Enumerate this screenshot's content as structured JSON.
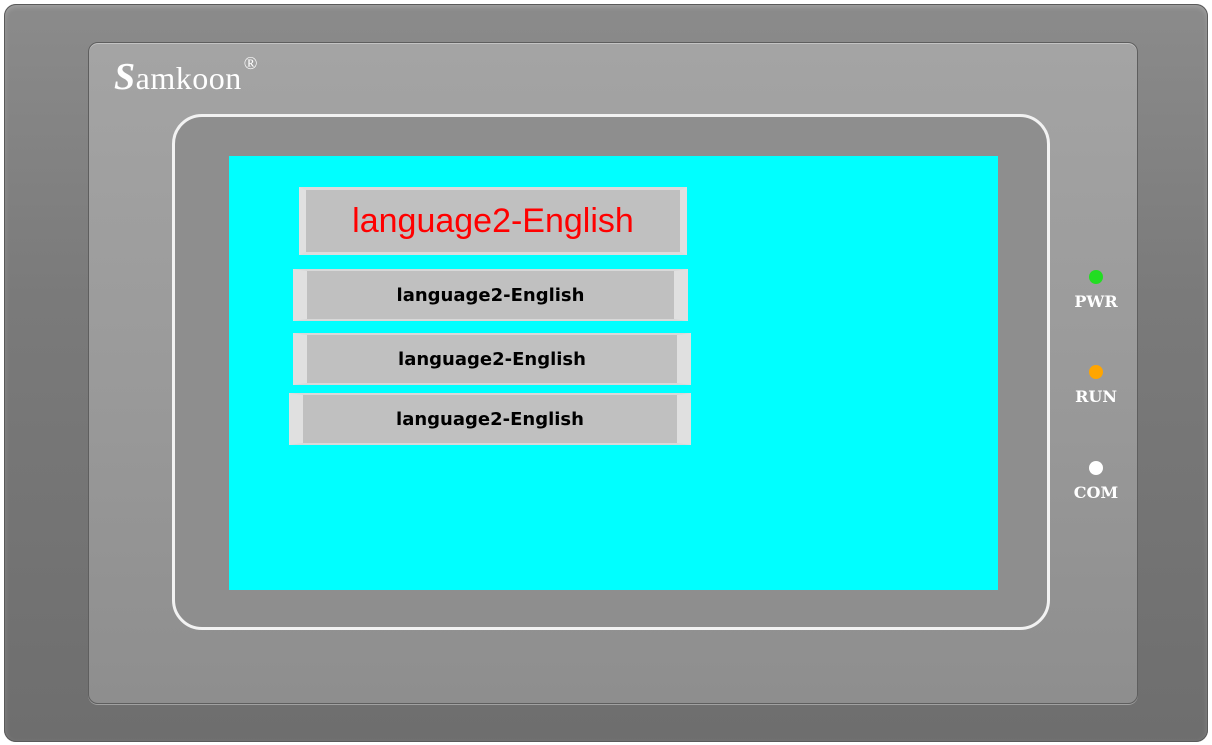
{
  "device": {
    "brand": "Samkoon",
    "brand_initial": "S",
    "brand_rest": "amkoon",
    "registered_mark": "®"
  },
  "screen": {
    "background_color": "#00ffff",
    "title": "language2-English",
    "title_color": "#ff0000",
    "buttons": [
      {
        "label": "language2-English"
      },
      {
        "label": "language2-English"
      },
      {
        "label": "language2-English"
      }
    ]
  },
  "indicators": [
    {
      "label": "PWR",
      "color": "#22dd22"
    },
    {
      "label": "RUN",
      "color": "#ffa500"
    },
    {
      "label": "COM",
      "color": "#ffffff"
    }
  ]
}
